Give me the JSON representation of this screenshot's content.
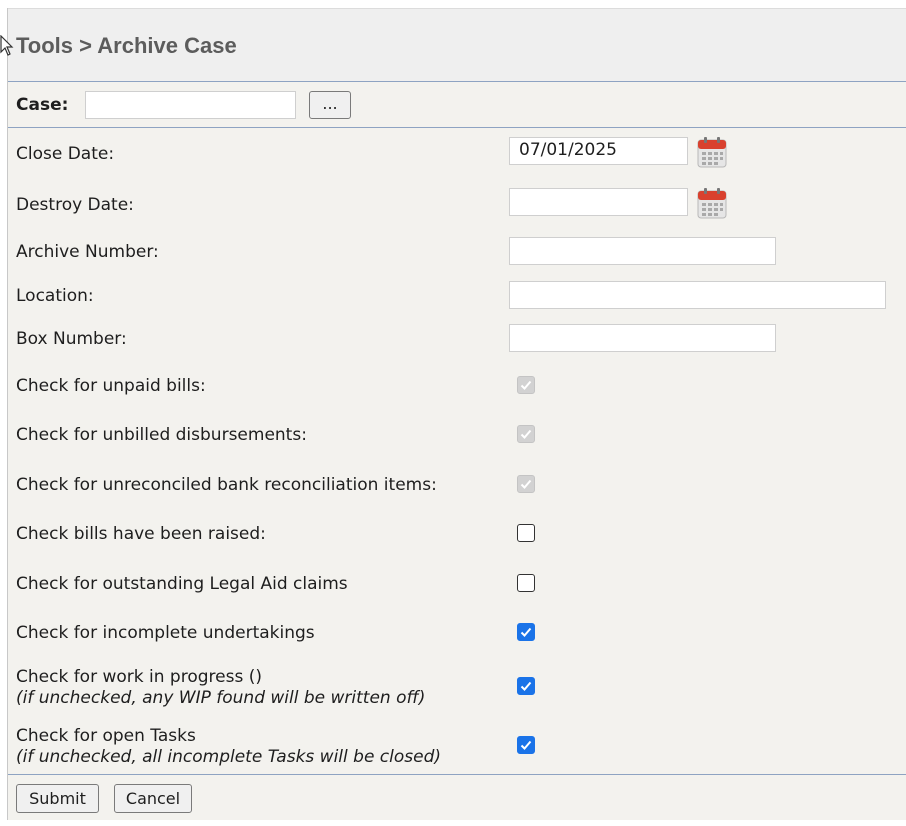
{
  "header": {
    "breadcrumb": "Tools > Archive Case"
  },
  "case": {
    "label": "Case:",
    "value": "",
    "browse_label": "..."
  },
  "fields": {
    "close_date": {
      "label": "Close Date:",
      "value": "07/01/2025"
    },
    "destroy_date": {
      "label": "Destroy Date:",
      "value": ""
    },
    "archive_number": {
      "label": "Archive Number:",
      "value": ""
    },
    "location": {
      "label": "Location:",
      "value": ""
    },
    "box_number": {
      "label": "Box Number:",
      "value": ""
    }
  },
  "checks": {
    "unpaid_bills": {
      "label": "Check for unpaid bills:",
      "checked": true,
      "disabled": true
    },
    "unbilled_disbursements": {
      "label": "Check for unbilled disbursements:",
      "checked": true,
      "disabled": true
    },
    "unreconciled_bank": {
      "label": "Check for unreconciled bank reconciliation items:",
      "checked": true,
      "disabled": true
    },
    "bills_raised": {
      "label": "Check bills have been raised:",
      "checked": false,
      "disabled": false
    },
    "legal_aid": {
      "label": "Check for outstanding Legal Aid claims",
      "checked": false,
      "disabled": false
    },
    "undertakings": {
      "label": "Check for incomplete undertakings",
      "checked": true,
      "disabled": false
    },
    "work_in_progress": {
      "label": "Check for work in progress ()",
      "note": "(if unchecked, any WIP found will be written off)",
      "checked": true,
      "disabled": false
    },
    "open_tasks": {
      "label": "Check for open Tasks",
      "note": "(if unchecked, all incomplete Tasks will be closed)",
      "checked": true,
      "disabled": false
    }
  },
  "buttons": {
    "submit": "Submit",
    "cancel": "Cancel"
  },
  "icons": {
    "calendar": "calendar-icon",
    "checkmark": "checkmark-icon",
    "cursor": "mouse-pointer-icon"
  },
  "colors": {
    "checkbox_checked": "#1a73e8",
    "checkbox_disabled": "#d2d2d2",
    "divider": "#8ea3c2",
    "calendar_red": "#d9412e",
    "title_text": "#5c5c5c"
  }
}
